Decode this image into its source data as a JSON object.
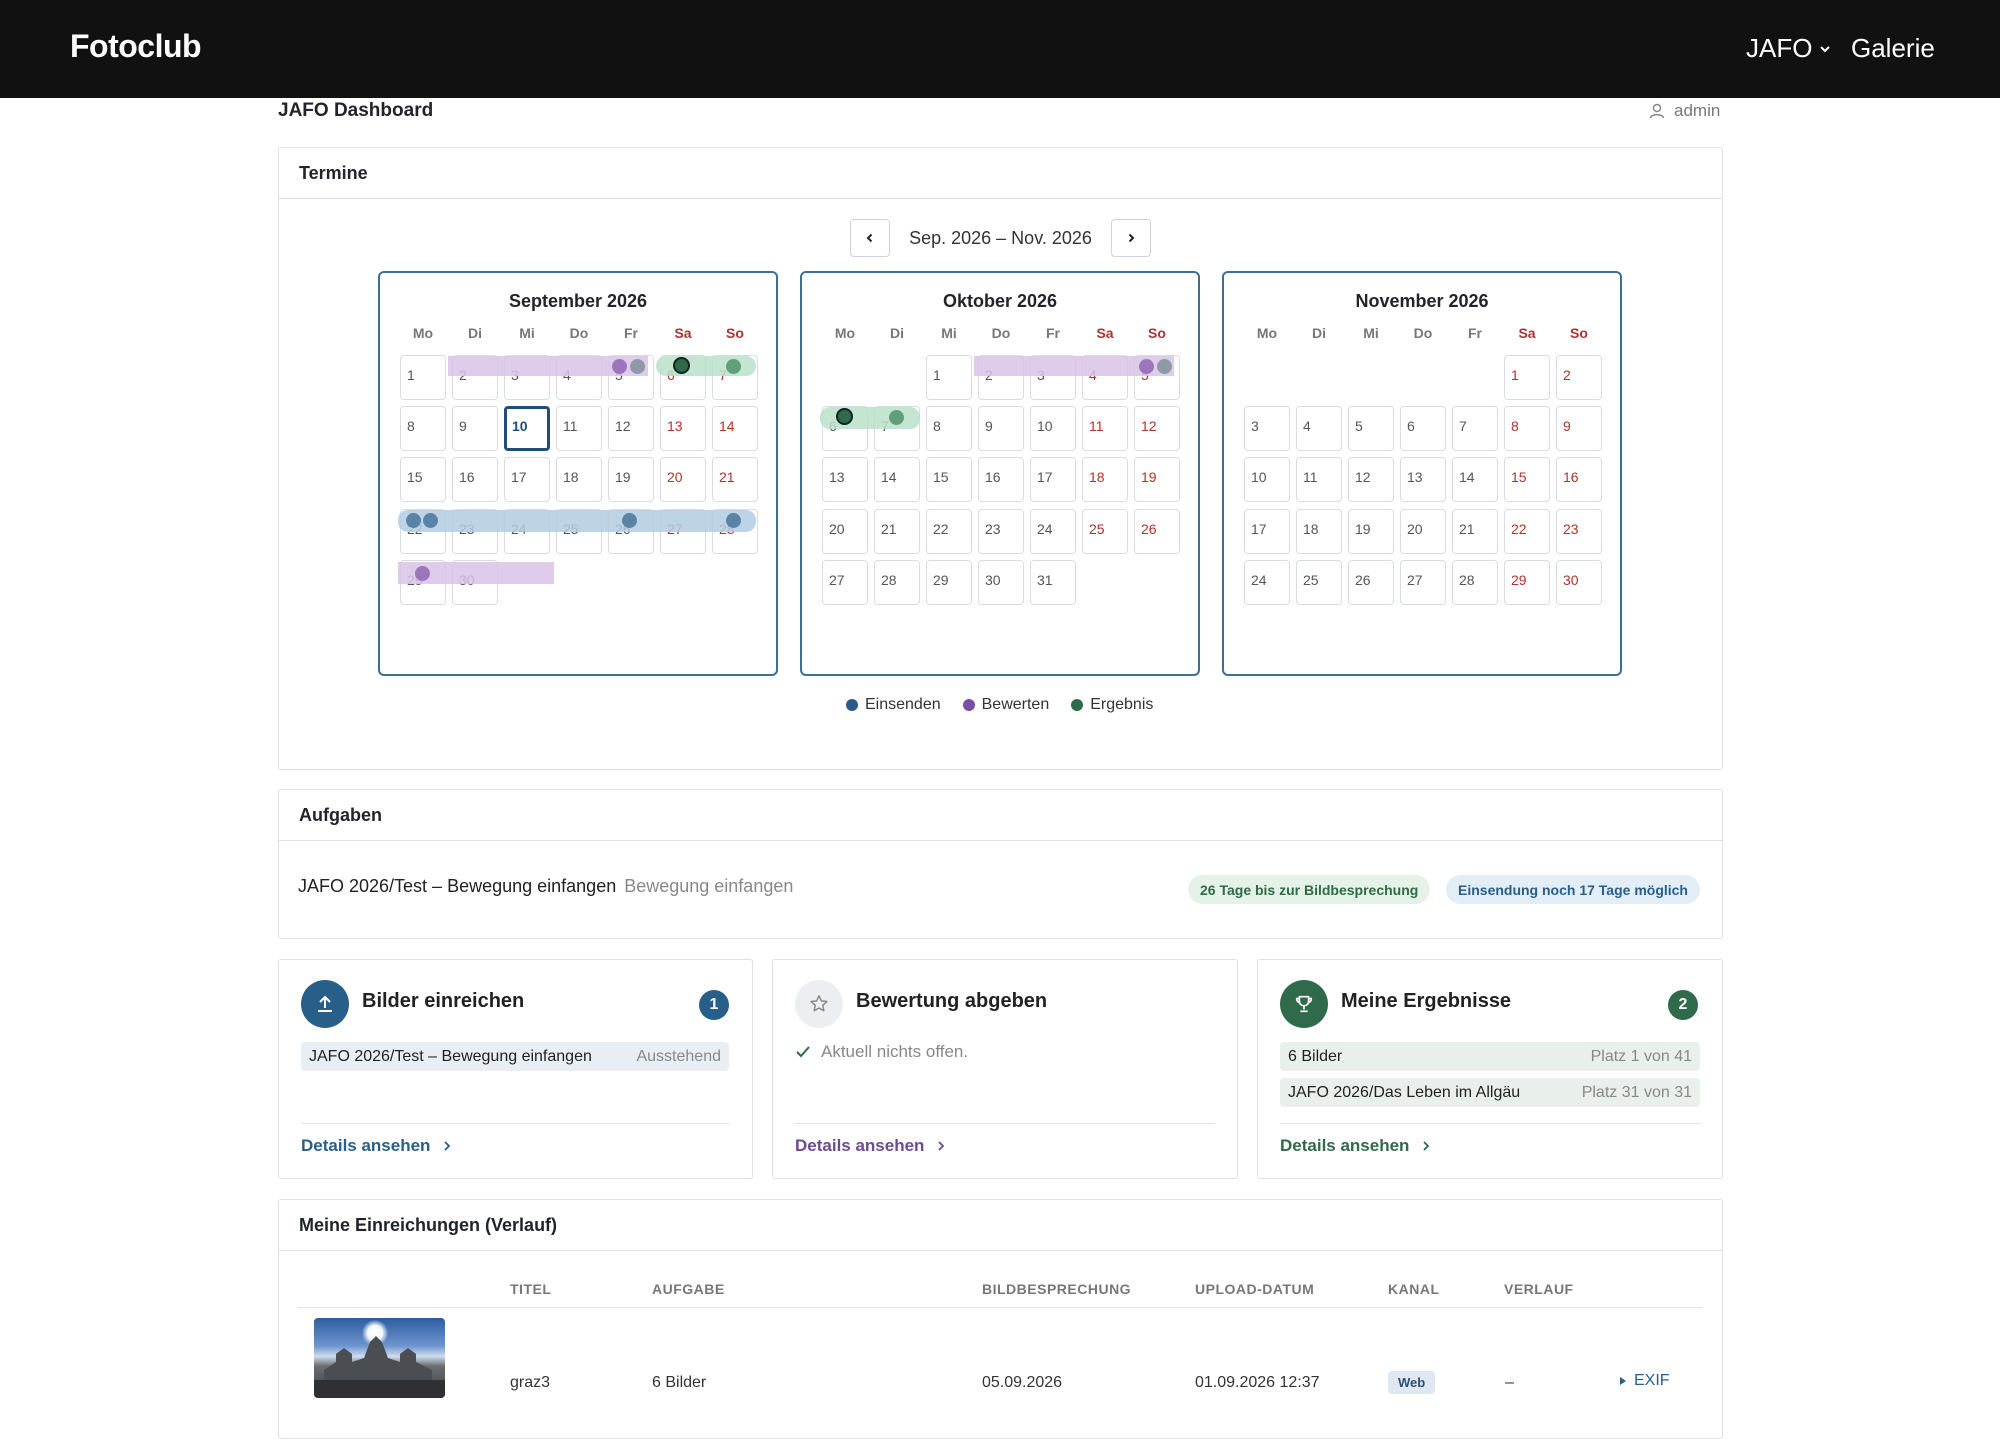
{
  "navbar": {
    "brand": "Fotoclub",
    "jafo_menu": "JAFO",
    "galerie": "Galerie"
  },
  "page": {
    "title": "JAFO Dashboard",
    "user": "admin"
  },
  "termine": {
    "header": "Termine",
    "range_label": "Sep. 2026 – Nov. 2026",
    "weekdays": [
      "Mo",
      "Di",
      "Mi",
      "Do",
      "Fr",
      "Sa",
      "So"
    ],
    "months": [
      {
        "title": "September 2026",
        "first_weekday": 1,
        "days": 30,
        "today": 10
      },
      {
        "title": "Oktober 2026",
        "first_weekday": 3,
        "days": 31,
        "today": null
      },
      {
        "title": "November 2026",
        "first_weekday": 6,
        "days": 30,
        "today": null
      }
    ],
    "legend": [
      {
        "label": "Einsenden",
        "color": "#2c5a88"
      },
      {
        "label": "Bewerten",
        "color": "#7b4ea6"
      },
      {
        "label": "Ergebnis",
        "color": "#2f6b4b"
      }
    ]
  },
  "aufgaben": {
    "header": "Aufgaben",
    "task_title": "JAFO 2026/Test – Bewegung einfangen",
    "task_subtitle": "Bewegung einfangen",
    "pill_review": "26 Tage bis zur Bildbesprechung",
    "pill_submit": "Einsendung noch 17 Tage möglich"
  },
  "cards": {
    "submit": {
      "title": "Bilder einreichen",
      "count": "1",
      "item_title": "JAFO 2026/Test – Bewegung einfangen",
      "item_status": "Ausstehend",
      "link": "Details ansehen",
      "color": "#285f8a"
    },
    "rate": {
      "title": "Bewertung abgeben",
      "empty_text": "Aktuell nichts offen.",
      "link": "Details ansehen",
      "color": "#6e4a91"
    },
    "results": {
      "title": "Meine Ergebnisse",
      "count": "2",
      "items": [
        {
          "title": "6 Bilder",
          "rank": "Platz 1 von 41"
        },
        {
          "title": "JAFO 2026/Das Leben im Allgäu",
          "rank": "Platz 31 von 31"
        }
      ],
      "link": "Details ansehen",
      "color": "#2f6b4b"
    }
  },
  "history": {
    "header": "Meine Einreichungen (Verlauf)",
    "columns": [
      "TITEL",
      "AUFGABE",
      "BILDBESPRECHUNG",
      "UPLOAD-DATUM",
      "KANAL",
      "VERLAUF"
    ],
    "rows": [
      {
        "title": "graz3",
        "task": "6 Bilder",
        "review": "05.09.2026",
        "upload": "01.09.2026 12:37",
        "channel": "Web",
        "history": "–",
        "action": "EXIF"
      }
    ]
  }
}
